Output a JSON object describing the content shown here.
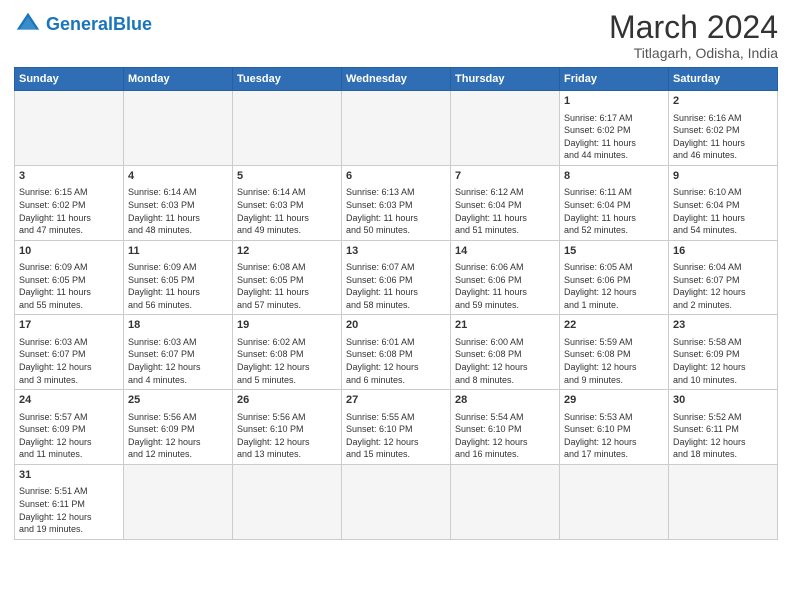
{
  "header": {
    "logo_general": "General",
    "logo_blue": "Blue",
    "month_title": "March 2024",
    "subtitle": "Titlagarh, Odisha, India"
  },
  "days_of_week": [
    "Sunday",
    "Monday",
    "Tuesday",
    "Wednesday",
    "Thursday",
    "Friday",
    "Saturday"
  ],
  "weeks": [
    [
      {
        "day": "",
        "info": "",
        "empty": true
      },
      {
        "day": "",
        "info": "",
        "empty": true
      },
      {
        "day": "",
        "info": "",
        "empty": true
      },
      {
        "day": "",
        "info": "",
        "empty": true
      },
      {
        "day": "",
        "info": "",
        "empty": true
      },
      {
        "day": "1",
        "info": "Sunrise: 6:17 AM\nSunset: 6:02 PM\nDaylight: 11 hours\nand 44 minutes.",
        "empty": false
      },
      {
        "day": "2",
        "info": "Sunrise: 6:16 AM\nSunset: 6:02 PM\nDaylight: 11 hours\nand 46 minutes.",
        "empty": false
      }
    ],
    [
      {
        "day": "3",
        "info": "Sunrise: 6:15 AM\nSunset: 6:02 PM\nDaylight: 11 hours\nand 47 minutes.",
        "empty": false
      },
      {
        "day": "4",
        "info": "Sunrise: 6:14 AM\nSunset: 6:03 PM\nDaylight: 11 hours\nand 48 minutes.",
        "empty": false
      },
      {
        "day": "5",
        "info": "Sunrise: 6:14 AM\nSunset: 6:03 PM\nDaylight: 11 hours\nand 49 minutes.",
        "empty": false
      },
      {
        "day": "6",
        "info": "Sunrise: 6:13 AM\nSunset: 6:03 PM\nDaylight: 11 hours\nand 50 minutes.",
        "empty": false
      },
      {
        "day": "7",
        "info": "Sunrise: 6:12 AM\nSunset: 6:04 PM\nDaylight: 11 hours\nand 51 minutes.",
        "empty": false
      },
      {
        "day": "8",
        "info": "Sunrise: 6:11 AM\nSunset: 6:04 PM\nDaylight: 11 hours\nand 52 minutes.",
        "empty": false
      },
      {
        "day": "9",
        "info": "Sunrise: 6:10 AM\nSunset: 6:04 PM\nDaylight: 11 hours\nand 54 minutes.",
        "empty": false
      }
    ],
    [
      {
        "day": "10",
        "info": "Sunrise: 6:09 AM\nSunset: 6:05 PM\nDaylight: 11 hours\nand 55 minutes.",
        "empty": false
      },
      {
        "day": "11",
        "info": "Sunrise: 6:09 AM\nSunset: 6:05 PM\nDaylight: 11 hours\nand 56 minutes.",
        "empty": false
      },
      {
        "day": "12",
        "info": "Sunrise: 6:08 AM\nSunset: 6:05 PM\nDaylight: 11 hours\nand 57 minutes.",
        "empty": false
      },
      {
        "day": "13",
        "info": "Sunrise: 6:07 AM\nSunset: 6:06 PM\nDaylight: 11 hours\nand 58 minutes.",
        "empty": false
      },
      {
        "day": "14",
        "info": "Sunrise: 6:06 AM\nSunset: 6:06 PM\nDaylight: 11 hours\nand 59 minutes.",
        "empty": false
      },
      {
        "day": "15",
        "info": "Sunrise: 6:05 AM\nSunset: 6:06 PM\nDaylight: 12 hours\nand 1 minute.",
        "empty": false
      },
      {
        "day": "16",
        "info": "Sunrise: 6:04 AM\nSunset: 6:07 PM\nDaylight: 12 hours\nand 2 minutes.",
        "empty": false
      }
    ],
    [
      {
        "day": "17",
        "info": "Sunrise: 6:03 AM\nSunset: 6:07 PM\nDaylight: 12 hours\nand 3 minutes.",
        "empty": false
      },
      {
        "day": "18",
        "info": "Sunrise: 6:03 AM\nSunset: 6:07 PM\nDaylight: 12 hours\nand 4 minutes.",
        "empty": false
      },
      {
        "day": "19",
        "info": "Sunrise: 6:02 AM\nSunset: 6:08 PM\nDaylight: 12 hours\nand 5 minutes.",
        "empty": false
      },
      {
        "day": "20",
        "info": "Sunrise: 6:01 AM\nSunset: 6:08 PM\nDaylight: 12 hours\nand 6 minutes.",
        "empty": false
      },
      {
        "day": "21",
        "info": "Sunrise: 6:00 AM\nSunset: 6:08 PM\nDaylight: 12 hours\nand 8 minutes.",
        "empty": false
      },
      {
        "day": "22",
        "info": "Sunrise: 5:59 AM\nSunset: 6:08 PM\nDaylight: 12 hours\nand 9 minutes.",
        "empty": false
      },
      {
        "day": "23",
        "info": "Sunrise: 5:58 AM\nSunset: 6:09 PM\nDaylight: 12 hours\nand 10 minutes.",
        "empty": false
      }
    ],
    [
      {
        "day": "24",
        "info": "Sunrise: 5:57 AM\nSunset: 6:09 PM\nDaylight: 12 hours\nand 11 minutes.",
        "empty": false
      },
      {
        "day": "25",
        "info": "Sunrise: 5:56 AM\nSunset: 6:09 PM\nDaylight: 12 hours\nand 12 minutes.",
        "empty": false
      },
      {
        "day": "26",
        "info": "Sunrise: 5:56 AM\nSunset: 6:10 PM\nDaylight: 12 hours\nand 13 minutes.",
        "empty": false
      },
      {
        "day": "27",
        "info": "Sunrise: 5:55 AM\nSunset: 6:10 PM\nDaylight: 12 hours\nand 15 minutes.",
        "empty": false
      },
      {
        "day": "28",
        "info": "Sunrise: 5:54 AM\nSunset: 6:10 PM\nDaylight: 12 hours\nand 16 minutes.",
        "empty": false
      },
      {
        "day": "29",
        "info": "Sunrise: 5:53 AM\nSunset: 6:10 PM\nDaylight: 12 hours\nand 17 minutes.",
        "empty": false
      },
      {
        "day": "30",
        "info": "Sunrise: 5:52 AM\nSunset: 6:11 PM\nDaylight: 12 hours\nand 18 minutes.",
        "empty": false
      }
    ],
    [
      {
        "day": "31",
        "info": "Sunrise: 5:51 AM\nSunset: 6:11 PM\nDaylight: 12 hours\nand 19 minutes.",
        "empty": false
      },
      {
        "day": "",
        "info": "",
        "empty": true
      },
      {
        "day": "",
        "info": "",
        "empty": true
      },
      {
        "day": "",
        "info": "",
        "empty": true
      },
      {
        "day": "",
        "info": "",
        "empty": true
      },
      {
        "day": "",
        "info": "",
        "empty": true
      },
      {
        "day": "",
        "info": "",
        "empty": true
      }
    ]
  ]
}
